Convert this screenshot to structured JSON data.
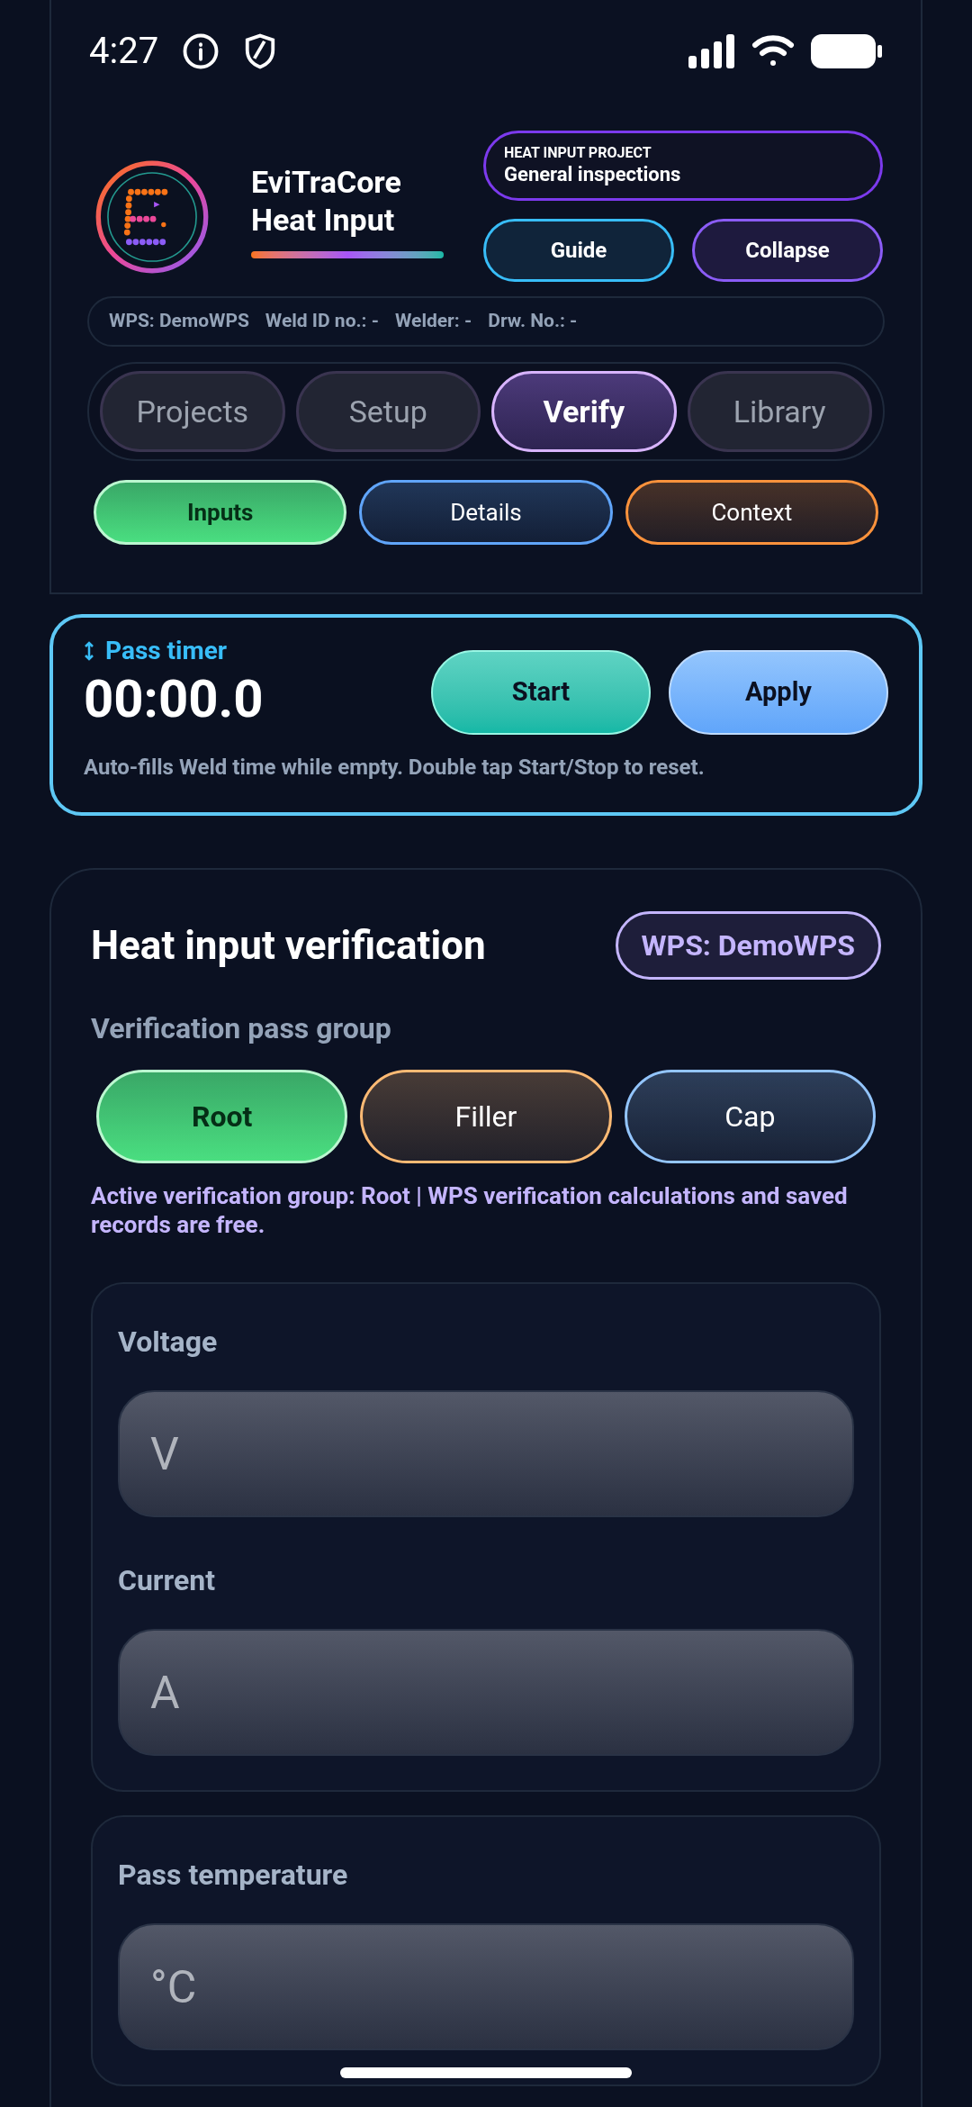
{
  "status_bar": {
    "time": "4:27"
  },
  "app": {
    "name_line_1": "EviTraCore",
    "name_line_2": "Heat Input"
  },
  "project": {
    "label": "HEAT INPUT PROJECT",
    "name": "General inspections"
  },
  "header_buttons": [
    {
      "label": "Guide",
      "kind": "guide"
    },
    {
      "label": "Collapse",
      "kind": "collapse"
    }
  ],
  "meta": [
    "WPS: DemoWPS",
    "Weld ID no.: -",
    "Welder: -",
    "Drw. No.: -"
  ],
  "tabs": [
    {
      "label": "Projects",
      "selected": false
    },
    {
      "label": "Setup",
      "selected": false
    },
    {
      "label": "Verify",
      "selected": true
    },
    {
      "label": "Library",
      "selected": false
    }
  ],
  "sub_tabs": [
    {
      "label": "Inputs",
      "selected": true,
      "color": "#4ade80"
    },
    {
      "label": "Details",
      "selected": false,
      "color": "#60a5fa"
    },
    {
      "label": "Context",
      "selected": false,
      "color": "#fb923c"
    }
  ],
  "timer": {
    "label": "Pass timer",
    "value": "00:00.0",
    "buttons": [
      {
        "label": "Start",
        "kind": "start"
      },
      {
        "label": "Apply",
        "kind": "apply"
      }
    ],
    "note": "Auto-fills Weld time while empty. Double tap Start/Stop to reset."
  },
  "verification": {
    "title": "Heat input verification",
    "badge": "WPS: DemoWPS",
    "group_label": "Verification pass group",
    "groups": [
      {
        "label": "Root",
        "selected": true,
        "color": "#4ade80"
      },
      {
        "label": "Filler",
        "selected": false,
        "color": "#fdba74"
      },
      {
        "label": "Cap",
        "selected": false,
        "color": "#93c5fd"
      }
    ],
    "active_note": "Active verification group: Root | WPS verification calculations and saved records are free."
  },
  "field_cards": [
    {
      "fields": [
        {
          "label": "Voltage",
          "placeholder": "V"
        },
        {
          "label": "Current",
          "placeholder": "A"
        }
      ]
    },
    {
      "fields": [
        {
          "label": "Pass temperature",
          "placeholder": "°C"
        }
      ]
    }
  ]
}
